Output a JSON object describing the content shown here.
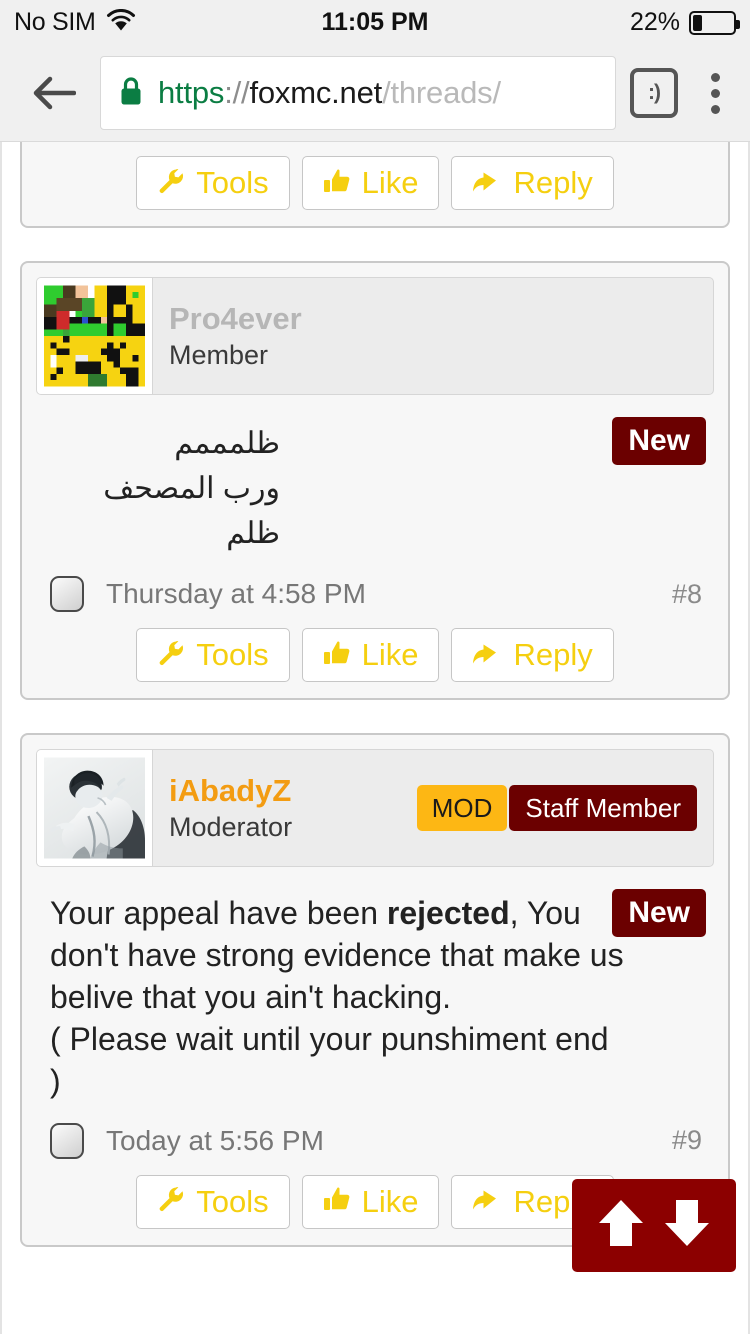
{
  "status_bar": {
    "carrier": "No SIM",
    "wifi_icon": "wifi-icon",
    "time": "11:05 PM",
    "battery_percent": "22%",
    "battery_level": 22
  },
  "browser": {
    "back_icon": "back-arrow-icon",
    "lock_icon": "lock-icon",
    "url": {
      "scheme": "https",
      "separator": "://",
      "host": "foxmc.net",
      "path": "/threads/"
    },
    "tabs_icon": "tab-switcher-icon",
    "tabs_label": ":)",
    "menu_icon": "overflow-menu-icon",
    "colors": {
      "scheme": "#0b7d43",
      "host": "#1b1b1b",
      "path": "#b9b9b9"
    }
  },
  "action_buttons": {
    "tools": {
      "label": "Tools",
      "icon": "wrench-icon"
    },
    "like": {
      "label": "Like",
      "icon": "thumbs-up-icon"
    },
    "reply": {
      "label": "Reply",
      "icon": "reply-arrow-icon"
    }
  },
  "posts": [
    {
      "clipped": true,
      "has_header": false,
      "has_body": false
    },
    {
      "clipped": false,
      "has_header": true,
      "has_body": true,
      "username": "Pro4ever",
      "username_color": "#b6b6b6",
      "user_title": "Member",
      "avatar": "pixel-minecraft-skin-avatar",
      "badges": [],
      "new_badge": "New",
      "message": "ظلمممم\nورب المصحف ظلم",
      "message_rtl": true,
      "timestamp": "Thursday at 4:58 PM",
      "post_number": "#8"
    },
    {
      "clipped": false,
      "has_header": true,
      "has_body": true,
      "username": "iAbadyZ",
      "username_color": "#f39c12",
      "user_title": "Moderator",
      "avatar": "grayscale-anime-avatar",
      "badges": [
        {
          "label": "MOD",
          "bg": "#fdb714",
          "fg": "#1a1a1a"
        },
        {
          "label": "Staff Member",
          "bg": "#6b0000",
          "fg": "#ffffff"
        }
      ],
      "new_badge": "New",
      "message_parts": [
        {
          "text": "Your appeal have been ",
          "bold": false
        },
        {
          "text": "rejected",
          "bold": true
        },
        {
          "text": ", You don't have strong evidence that make us belive that you ain't hacking.\n( Please wait until your punshiment end )",
          "bold": false
        }
      ],
      "message_rtl": false,
      "timestamp": "Today at 5:56 PM",
      "post_number": "#9"
    }
  ],
  "scroll_fab": {
    "up_icon": "arrow-up-icon",
    "down_icon": "arrow-down-icon",
    "color": "#8c0000"
  },
  "theme": {
    "accent_yellow": "#f5cf10",
    "dark_red": "#6b0000",
    "page_bg": "#ffffff",
    "card_bg": "#f7f7f7"
  }
}
